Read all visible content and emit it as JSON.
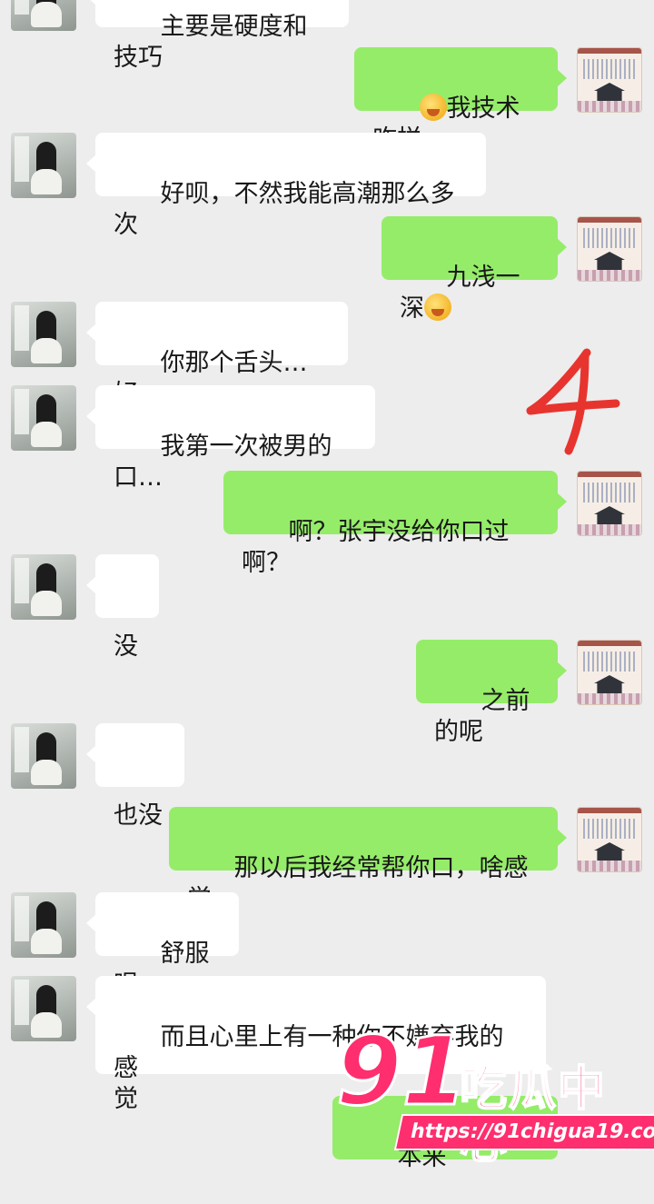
{
  "conversation": {
    "messages": [
      {
        "side": "left",
        "text": "主要是硬度和技巧"
      },
      {
        "side": "right",
        "text": "我技术咋样",
        "emoji_before": "grinning-hand-over-mouth-emoji"
      },
      {
        "side": "left",
        "text": "好呗，不然我能高潮那么多次"
      },
      {
        "side": "right",
        "text": "九浅一深",
        "emoji_after": "grinning-hand-over-mouth-emoji"
      },
      {
        "side": "left",
        "text": "你那个舌头…好…"
      },
      {
        "side": "left",
        "text": "我第一次被男的口…"
      },
      {
        "side": "right",
        "text": "啊？张宇没给你口过啊？"
      },
      {
        "side": "left",
        "text": "没"
      },
      {
        "side": "right",
        "text": "之前的呢"
      },
      {
        "side": "left",
        "text": "也没"
      },
      {
        "side": "right",
        "text": "那以后我经常帮你口，啥感觉"
      },
      {
        "side": "left",
        "text": "舒服呗…"
      },
      {
        "side": "left",
        "text": "而且心里上有一种你不嫌弃我的感\n觉"
      },
      {
        "side": "right",
        "text": "本来"
      }
    ]
  },
  "annotation": {
    "handwritten_number": "4",
    "color": "#e8342e"
  },
  "watermark": {
    "logo_number": "91",
    "logo_text": "吃瓜中心",
    "url": "https://91chigua19.com"
  },
  "colors": {
    "background": "#ededed",
    "bubble_left": "#ffffff",
    "bubble_right": "#95ec69",
    "watermark": "#ff2e6e"
  }
}
